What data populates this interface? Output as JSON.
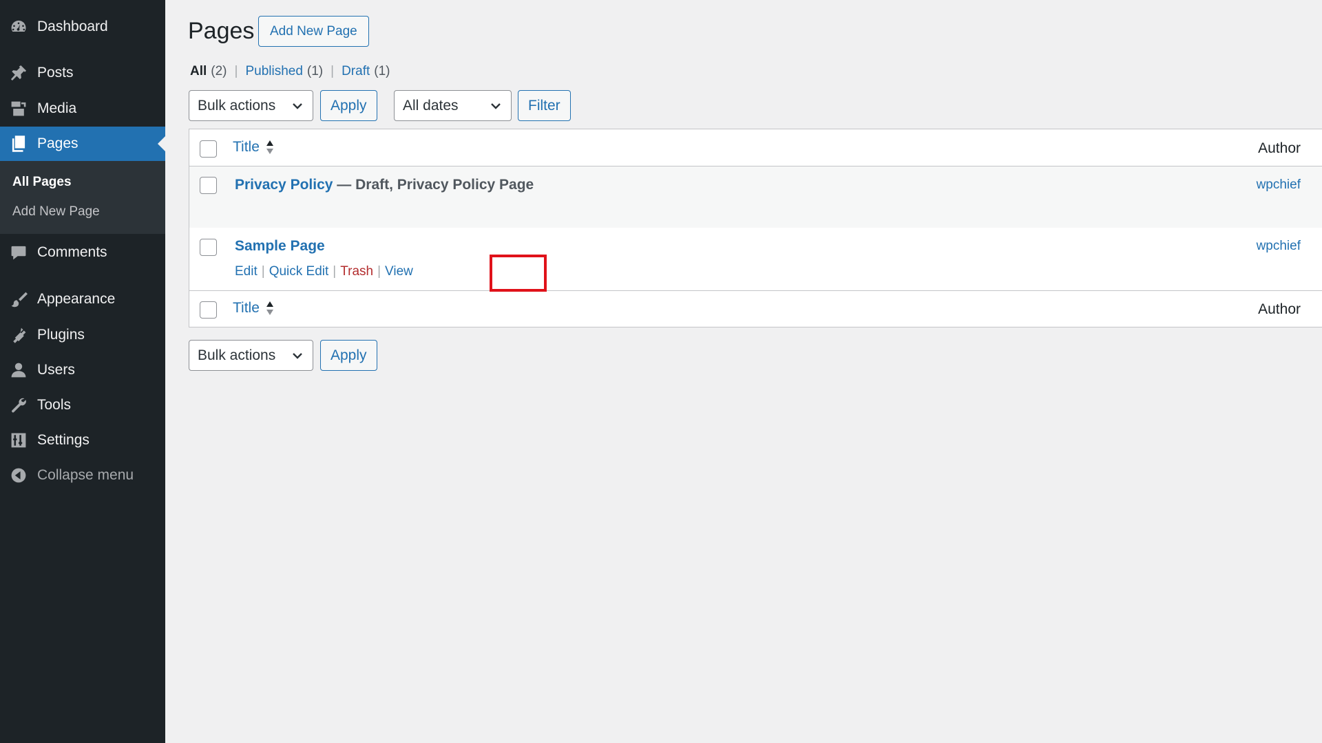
{
  "sidebar": {
    "items": [
      {
        "id": "dashboard",
        "label": "Dashboard",
        "icon": "dashboard-icon"
      },
      {
        "id": "posts",
        "label": "Posts",
        "icon": "pushpin-icon"
      },
      {
        "id": "media",
        "label": "Media",
        "icon": "media-icon"
      },
      {
        "id": "pages",
        "label": "Pages",
        "icon": "pages-icon",
        "active": true
      },
      {
        "id": "comments",
        "label": "Comments",
        "icon": "comment-icon"
      },
      {
        "id": "appearance",
        "label": "Appearance",
        "icon": "paintbrush-icon"
      },
      {
        "id": "plugins",
        "label": "Plugins",
        "icon": "plugin-icon"
      },
      {
        "id": "users",
        "label": "Users",
        "icon": "user-icon"
      },
      {
        "id": "tools",
        "label": "Tools",
        "icon": "wrench-icon"
      },
      {
        "id": "settings",
        "label": "Settings",
        "icon": "settings-icon"
      },
      {
        "id": "collapse",
        "label": "Collapse menu",
        "icon": "collapse-icon"
      }
    ],
    "submenu": [
      {
        "label": "All Pages",
        "current": true
      },
      {
        "label": "Add New Page"
      }
    ]
  },
  "header": {
    "title": "Pages",
    "add_new_label": "Add New Page"
  },
  "views": [
    {
      "label": "All",
      "count": "(2)",
      "current": true
    },
    {
      "label": "Published",
      "count": "(1)"
    },
    {
      "label": "Draft",
      "count": "(1)"
    }
  ],
  "views_separator": "|",
  "toolbar": {
    "bulk_actions": "Bulk actions",
    "apply": "Apply",
    "all_dates": "All dates",
    "filter": "Filter"
  },
  "table": {
    "col_title": "Title",
    "col_author": "Author",
    "rows": [
      {
        "title": "Privacy Policy",
        "state": " — Draft, Privacy Policy Page",
        "author": "wpchief"
      },
      {
        "title": "Sample Page",
        "state": "",
        "author": "wpchief",
        "actions": [
          "Edit",
          "Quick Edit",
          "Trash",
          "View"
        ]
      }
    ]
  },
  "bottom_toolbar": {
    "bulk_actions": "Bulk actions",
    "apply": "Apply"
  },
  "colors": {
    "sidebar_bg": "#1d2327",
    "accent": "#2271b1",
    "trash": "#b32d2e",
    "highlight": "#e0121a"
  }
}
